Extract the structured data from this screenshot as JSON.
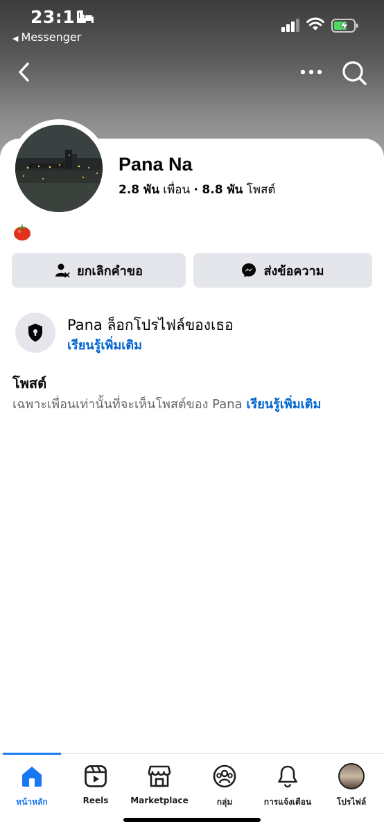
{
  "status_bar": {
    "time": "23:11",
    "back_app": "Messenger",
    "battery_color": "#4cd964"
  },
  "profile": {
    "name": "Pana Na",
    "friends_count": "2.8 พัน",
    "friends_label": "เพื่อน",
    "separator": "·",
    "posts_count": "8.8 พัน",
    "posts_label": "โพสต์",
    "bio_emoji": "tomato"
  },
  "actions": {
    "cancel_request": "ยกเลิกคำขอ",
    "send_message": "ส่งข้อความ"
  },
  "locked": {
    "title": "Pana ล็อกโปรไฟล์ของเธอ",
    "link": "เรียนรู้เพิ่มเติม"
  },
  "posts": {
    "title": "โพสต์",
    "description": "เฉพาะเพื่อนเท่านั้นที่จะเห็นโพสต์ของ Pana",
    "link": "เรียนรู้เพิ่มเติม"
  },
  "tabs": [
    {
      "label": "หน้าหลัก",
      "icon": "home-icon",
      "active": true
    },
    {
      "label": "Reels",
      "icon": "reels-icon",
      "active": false
    },
    {
      "label": "Marketplace",
      "icon": "marketplace-icon",
      "active": false
    },
    {
      "label": "กลุ่ม",
      "icon": "groups-icon",
      "active": false
    },
    {
      "label": "การแจ้งเตือน",
      "icon": "bell-icon",
      "active": false
    },
    {
      "label": "โปรไฟล์",
      "icon": "profile-avatar",
      "active": false
    }
  ],
  "colors": {
    "accent": "#1877f2",
    "link": "#0064d1",
    "button_bg": "#e4e6eb"
  }
}
